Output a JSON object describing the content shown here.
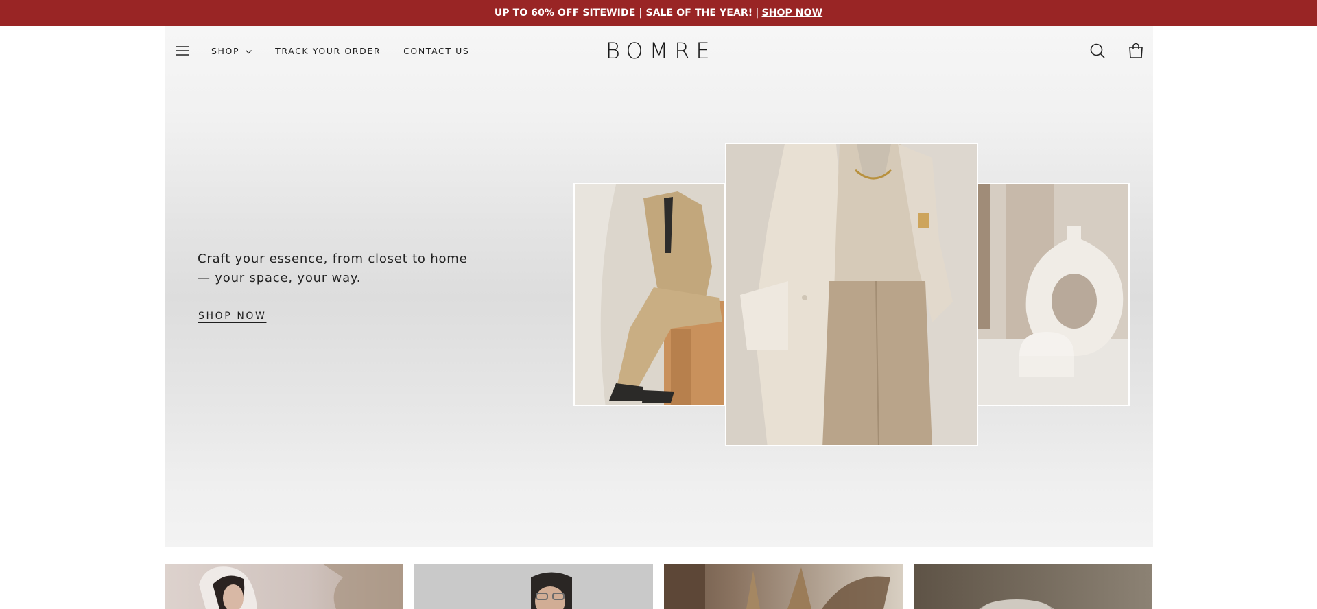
{
  "announcement": {
    "text": "UP TO 60% OFF SITEWIDE | SALE OF THE YEAR!",
    "separator": "|",
    "link": "SHOP NOW",
    "bg": "#992525"
  },
  "header": {
    "menu_icon": "hamburger-menu-icon",
    "nav": [
      {
        "label": "SHOP",
        "icon": "chevron-down-icon"
      },
      {
        "label": "TRACK YOUR ORDER"
      },
      {
        "label": "CONTACT US"
      }
    ],
    "logo": "BOMRE",
    "search_icon": "search-icon",
    "cart_icon": "shopping-bag-icon"
  },
  "hero": {
    "headline_line1": "Craft your essence, from closet to home",
    "headline_line2": "— your space, your way.",
    "cta": "SHOP NOW",
    "images": [
      "man-in-camel-suit-photo",
      "woman-in-beige-coat-photo",
      "ceramic-donut-vase-photo"
    ]
  },
  "collection_tiles": [
    "woman-portrait-photo",
    "man-with-glasses-photo",
    "dried-pampas-grass-photo",
    "home-decor-bowl-photo"
  ]
}
